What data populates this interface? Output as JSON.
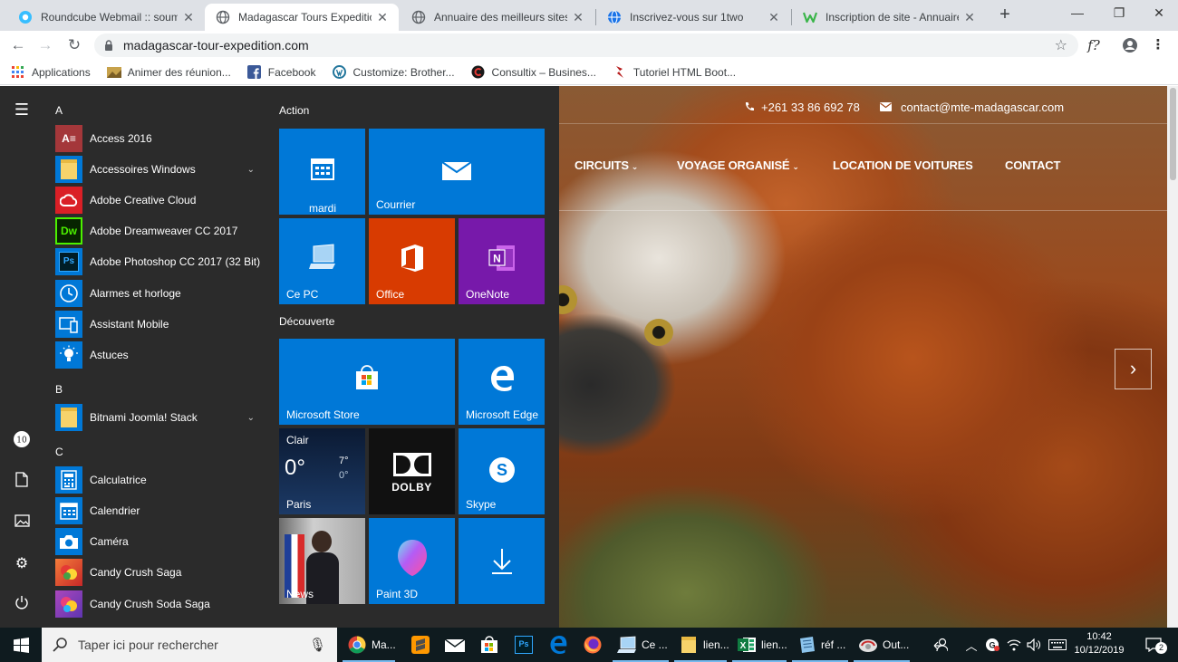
{
  "browser": {
    "tabs": [
      {
        "title": "Roundcube Webmail :: soumiss",
        "icon": "roundcube-icon"
      },
      {
        "title": "Madagascar Tours Expedition",
        "icon": "globe-icon",
        "active": true
      },
      {
        "title": "Annuaire des meilleurs sites In",
        "icon": "globe-icon"
      },
      {
        "title": "Inscrivez-vous sur 1two",
        "icon": "globe-blue-icon"
      },
      {
        "title": "Inscription de site - Annuaire s",
        "icon": "w-green-icon"
      }
    ],
    "new_tab": "+",
    "url": "madagascar-tour-expedition.com",
    "ext_label": "f?",
    "bookmarks": [
      {
        "label": "Applications",
        "icon": "apps-grid-icon"
      },
      {
        "label": "Animer des réunion...",
        "icon": "bookmark-image-icon"
      },
      {
        "label": "Facebook",
        "icon": "facebook-icon"
      },
      {
        "label": "Customize: Brother...",
        "icon": "wordpress-icon"
      },
      {
        "label": "Consultix – Busines...",
        "icon": "consultix-icon"
      },
      {
        "label": "Tutoriel HTML Boot...",
        "icon": "html-icon"
      }
    ]
  },
  "website": {
    "phone": "+261 33 86 692 78",
    "email": "contact@mte-madagascar.com",
    "nav": [
      {
        "label": "CIRCUITS",
        "dropdown": true
      },
      {
        "label": "VOYAGE ORGANISÉ",
        "dropdown": true
      },
      {
        "label": "LOCATION DE VOITURES",
        "dropdown": false
      },
      {
        "label": "CONTACT",
        "dropdown": false
      }
    ],
    "slider_next": "›"
  },
  "start_menu": {
    "letters": [
      "A",
      "B",
      "C"
    ],
    "apps": [
      {
        "label": "Access 2016",
        "icon": "access-icon",
        "color": "#a4373a",
        "glyph": "A"
      },
      {
        "label": "Accessoires Windows",
        "icon": "folder-icon",
        "color": "#f0c94e",
        "expand": true
      },
      {
        "label": "Adobe Creative Cloud",
        "icon": "creative-cloud-icon",
        "color": "#da1f26"
      },
      {
        "label": "Adobe Dreamweaver CC 2017",
        "icon": "dreamweaver-icon",
        "color": "#072401",
        "glyph": "Dw"
      },
      {
        "label": "Adobe Photoshop CC 2017 (32 Bit)",
        "icon": "photoshop-icon",
        "color": "#001d26",
        "glyph": "Ps"
      },
      {
        "label": "Alarmes et horloge",
        "icon": "alarm-clock-icon",
        "color": "#0078d7"
      },
      {
        "label": "Assistant Mobile",
        "icon": "mobile-assistant-icon",
        "color": "#0078d7"
      },
      {
        "label": "Astuces",
        "icon": "lightbulb-icon",
        "color": "#0078d7"
      },
      {
        "label": "Bitnami Joomla! Stack",
        "icon": "folder-icon",
        "color": "#f0c94e",
        "expand": true
      },
      {
        "label": "Calculatrice",
        "icon": "calculator-icon",
        "color": "#0078d7"
      },
      {
        "label": "Calendrier",
        "icon": "calendar-icon",
        "color": "#0078d7"
      },
      {
        "label": "Caméra",
        "icon": "camera-icon",
        "color": "#0078d7"
      },
      {
        "label": "Candy Crush Saga",
        "icon": "candy-crush-icon",
        "color": "#c94a2e"
      },
      {
        "label": "Candy Crush Soda Saga",
        "icon": "candy-crush-soda-icon",
        "color": "#8a3fa8"
      }
    ],
    "groups": [
      "Action",
      "Découverte"
    ],
    "tiles": {
      "calendar": "mardi",
      "mail": "Courrier",
      "this_pc": "Ce PC",
      "office": "Office",
      "onenote": "OneNote",
      "store": "Microsoft Store",
      "edge": "Microsoft Edge",
      "weather_condition": "Clair",
      "weather_temp": "0°",
      "weather_high": "7°",
      "weather_low": "0°",
      "weather_city": "Paris",
      "dolby": "DOLBY",
      "skype": "Skype",
      "news": "News",
      "paint3d": "Paint 3D"
    },
    "colors": {
      "tile_blue": "#0078d7",
      "office": "#d83b01",
      "onenote": "#7719aa",
      "dolby": "#111111"
    }
  },
  "taskbar": {
    "search_placeholder": "Taper ici pour rechercher",
    "items": [
      {
        "label": "Ma...",
        "icon": "chrome-icon"
      },
      {
        "label": "",
        "icon": "sublime-icon"
      },
      {
        "label": "",
        "icon": "mail-icon"
      },
      {
        "label": "",
        "icon": "store-icon"
      },
      {
        "label": "",
        "icon": "photoshop-icon"
      },
      {
        "label": "",
        "icon": "edge-icon"
      },
      {
        "label": "",
        "icon": "firefox-icon"
      },
      {
        "label": "Ce ...",
        "icon": "this-pc-icon"
      },
      {
        "label": "lien...",
        "icon": "folder-icon"
      },
      {
        "label": "lien...",
        "icon": "excel-icon"
      },
      {
        "label": "réf ...",
        "icon": "notepad-icon"
      },
      {
        "label": "Out...",
        "icon": "outlook-icon"
      }
    ],
    "time": "10:42",
    "date": "10/12/2019",
    "notification_count": "2"
  }
}
